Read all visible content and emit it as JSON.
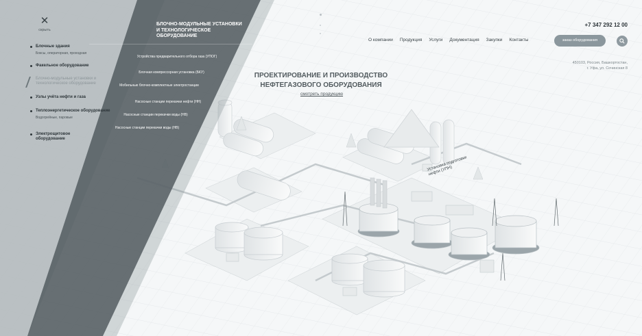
{
  "close": {
    "icon": "close-icon",
    "label": "скрыть"
  },
  "left_nav": {
    "items": [
      {
        "title": "Блочные здания",
        "subtitle": "Боксы, операторная, проходная"
      },
      {
        "title": "Факельное оборудование",
        "subtitle": ""
      },
      {
        "title": "Блочно-модульные установки и технологическое оборудование",
        "subtitle": ""
      },
      {
        "title": "Узлы учёта нефти и газа",
        "subtitle": ""
      },
      {
        "title": "Теплоэнергетическое оборудование",
        "subtitle": "Водогрейные, паровые"
      },
      {
        "title": "Электрощитовое оборудование",
        "subtitle": ""
      }
    ]
  },
  "panel": {
    "title": "БЛОЧНО-МОДУЛЬНЫЕ УСТАНОВКИ И ТЕХНОЛОГИЧЕСКОЕ ОБОРУДОВАНИЕ",
    "items": [
      "Устройства предварительного отбора газа (УПОГ)",
      "Блочная компрессорная установка (БКУ)",
      "Мобильные блочно-комплектные электростанции",
      "Насосные станции перекачки нефти (НН)",
      "Насосные станции перекачки воды (НВ)",
      "Насосные станции перекачки воды (НВ)"
    ]
  },
  "header": {
    "phone": "+7 347 292 12 00",
    "nav": [
      "О компании",
      "Продукция",
      "Услуги",
      "Документация",
      "Закупки",
      "Контакты"
    ],
    "order_button": "заказ оборудования",
    "search_icon": "search-icon",
    "address": [
      "450103, Россия, Башкортостан,",
      "г. Уфа, ул. Сочинская 8"
    ]
  },
  "hero": {
    "title_line1": "ПРОЕКТИРОВАНИЕ И ПРОИЗВОДСТВО",
    "title_line2": "НЕФТЕГАЗОВОГО ОБОРУДОВАНИЯ",
    "link": "смотреть продукцию"
  },
  "scene": {
    "label_line1": "Установка подготовки",
    "label_line2": "нефти (УПН)"
  },
  "colors": {
    "dark_panel": "#5b6468",
    "light_panel": "#b4bbbe",
    "button": "#8b979d",
    "background": "#f4f6f7"
  }
}
